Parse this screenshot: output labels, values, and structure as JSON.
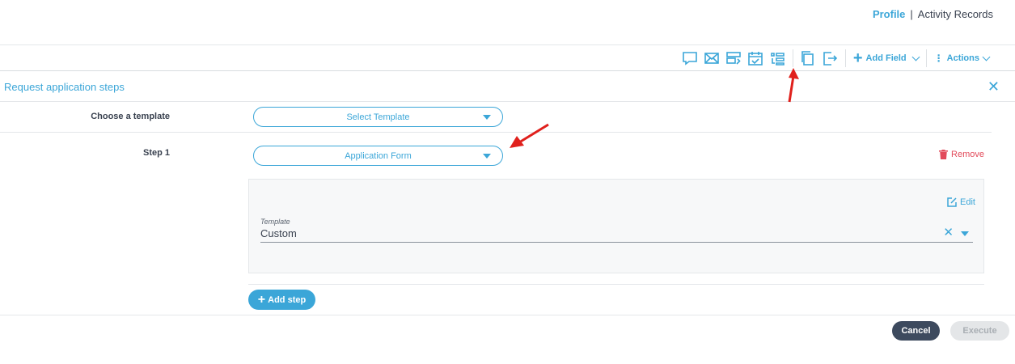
{
  "topnav": {
    "active": "Profile",
    "separator": "|",
    "link": "Activity Records"
  },
  "toolbar": {
    "icons": [
      "chat-icon",
      "mail-icon",
      "list-edit-icon",
      "calendar-check-icon",
      "steps-icon",
      "copy-icon",
      "export-icon"
    ],
    "add_field_label": "Add Field",
    "add_field_plus": "+",
    "actions_label": "Actions",
    "actions_prefix": "⋮"
  },
  "panel": {
    "title": "Request application steps",
    "close": "✕",
    "choose_template_label": "Choose a template",
    "template_select": "Select Template",
    "step_label": "Step 1",
    "step_select": "Application Form",
    "remove_label": "Remove",
    "edit_label": "Edit",
    "template_field_label": "Template",
    "template_field_value": "Custom",
    "template_clear": "✕",
    "add_step_label": "Add step",
    "add_step_plus": "+"
  },
  "footer": {
    "cancel_label": "Cancel",
    "execute_label": "Execute"
  },
  "colors": {
    "accent": "#3ba6d8",
    "danger": "#e24b5b",
    "cancel_bg": "#3d4a5e",
    "annotation_arrow": "#e0201c"
  }
}
